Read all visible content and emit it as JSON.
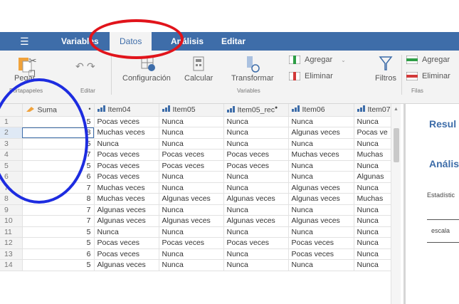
{
  "ribbon": {
    "menu_icon": "hamburger-icon",
    "tabs": [
      "Variables",
      "Datos",
      "Análisis",
      "Editar"
    ]
  },
  "toolbar": {
    "paste": "Pegar",
    "clipboard_group": "Portapapeles",
    "edit_group": "Editar",
    "configuracion": "Configuración",
    "calcular": "Calcular",
    "transformar": "Transformar",
    "variables_group": "Variables",
    "agregar": "Agregar",
    "eliminar": "Eliminar",
    "filtros": "Filtros",
    "agregar_filas": "Agregar",
    "eliminar_filas": "Eliminar",
    "filas_group": "Filas"
  },
  "grid": {
    "columns": [
      "Suma",
      "Item04",
      "Item05",
      "Item05_rec",
      "Item06",
      "Item07"
    ],
    "rows": [
      [
        "1",
        "5",
        "Pocas veces",
        "Nunca",
        "Nunca",
        "Nunca",
        "Nunca"
      ],
      [
        "2",
        "8",
        "Muchas veces",
        "Nunca",
        "Nunca",
        "Algunas veces",
        "Pocas ve"
      ],
      [
        "3",
        "5",
        "Nunca",
        "Nunca",
        "Nunca",
        "Nunca",
        "Nunca"
      ],
      [
        "4",
        "7",
        "Pocas veces",
        "Pocas veces",
        "Pocas veces",
        "Muchas veces",
        "Muchas"
      ],
      [
        "5",
        "5",
        "Pocas veces",
        "Pocas veces",
        "Pocas veces",
        "Nunca",
        "Nunca"
      ],
      [
        "6",
        "6",
        "Pocas veces",
        "Nunca",
        "Nunca",
        "Nunca",
        "Algunas"
      ],
      [
        "7",
        "7",
        "Muchas veces",
        "Nunca",
        "Nunca",
        "Algunas veces",
        "Nunca"
      ],
      [
        "8",
        "8",
        "Muchas veces",
        "Algunas veces",
        "Algunas veces",
        "Algunas veces",
        "Muchas"
      ],
      [
        "9",
        "7",
        "Algunas veces",
        "Nunca",
        "Nunca",
        "Nunca",
        "Nunca"
      ],
      [
        "10",
        "7",
        "Algunas veces",
        "Algunas veces",
        "Algunas veces",
        "Algunas veces",
        "Nunca"
      ],
      [
        "11",
        "5",
        "Nunca",
        "Nunca",
        "Nunca",
        "Nunca",
        "Nunca"
      ],
      [
        "12",
        "5",
        "Pocas veces",
        "Pocas veces",
        "Pocas veces",
        "Pocas veces",
        "Nunca"
      ],
      [
        "13",
        "6",
        "Pocas veces",
        "Nunca",
        "Nunca",
        "Pocas veces",
        "Nunca"
      ],
      [
        "14",
        "5",
        "Algunas veces",
        "Nunca",
        "Nunca",
        "Nunca",
        "Nunca"
      ]
    ]
  },
  "results": {
    "title": "Resul",
    "analysis": "Anális",
    "stat_label": "Estadístic",
    "scale_label": "escala"
  },
  "colors": {
    "accent": "#3e6da9",
    "annotation_red": "#e1141b",
    "annotation_blue": "#1d2ce0"
  }
}
